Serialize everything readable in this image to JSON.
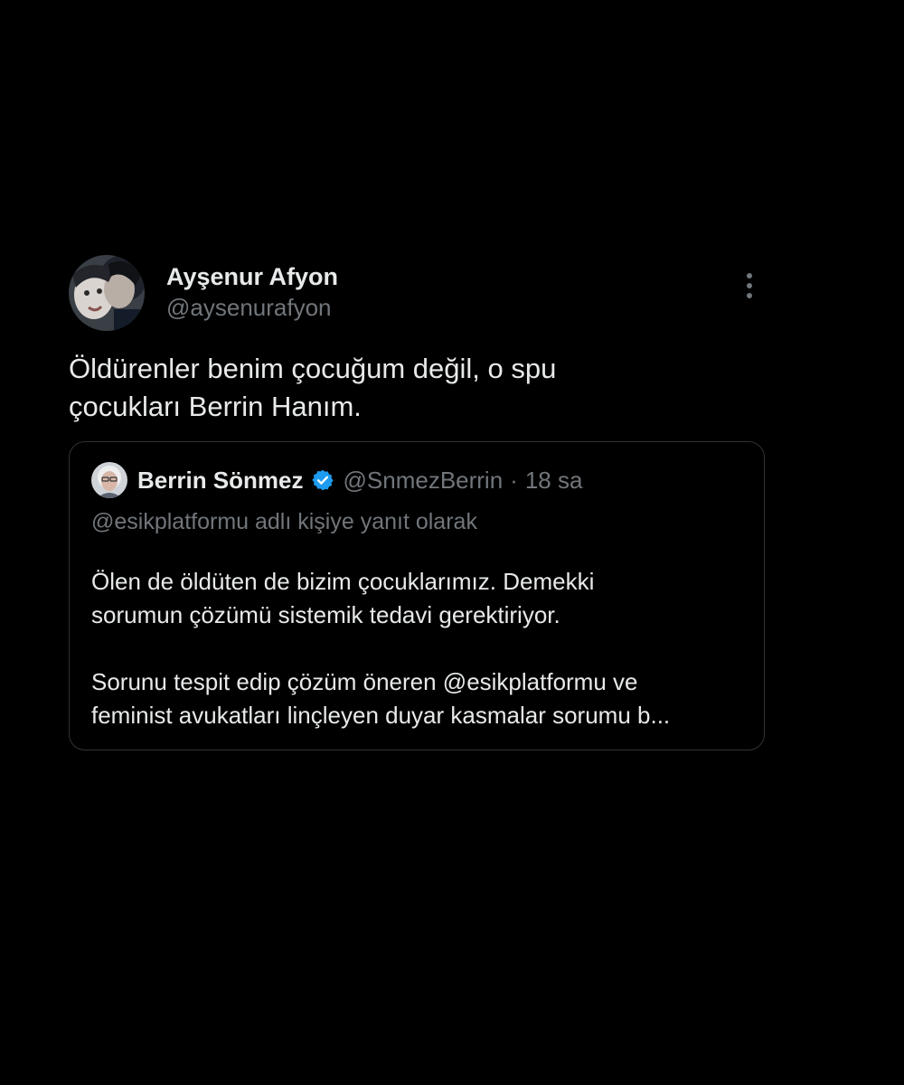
{
  "tweet": {
    "author_name": "Ayşenur Afyon",
    "author_handle": "@aysenurafyon",
    "avatar_icon": "profile-photo",
    "more_icon": "more-options-icon",
    "text_line1": "Öldürenler benim çocuğum değil, o  spu",
    "text_line2": "çocukları Berrin Hanım."
  },
  "quote": {
    "author_name": "Berrin Sönmez",
    "verified_icon": "verified-badge-icon",
    "author_handle": "@SnmezBerrin",
    "separator": "·",
    "time": "18 sa",
    "reply_to": "@esikplatformu adlı kişiye yanıt olarak",
    "body_line1": "Ölen de öldüten de bizim çocuklarımız. Demekki",
    "body_line2": "sorumun çözümü sistemik tedavi gerektiriyor.",
    "body_line3": "Sorunu tespit edip çözüm öneren @esikplatformu ve",
    "body_line4": "feminist avukatları linçleyen duyar kasmalar sorumu b..."
  },
  "colors": {
    "background": "#000000",
    "text_primary": "#e7e9ea",
    "text_secondary": "#71767b",
    "border": "#2f3336",
    "verified": "#1d9bf0"
  }
}
